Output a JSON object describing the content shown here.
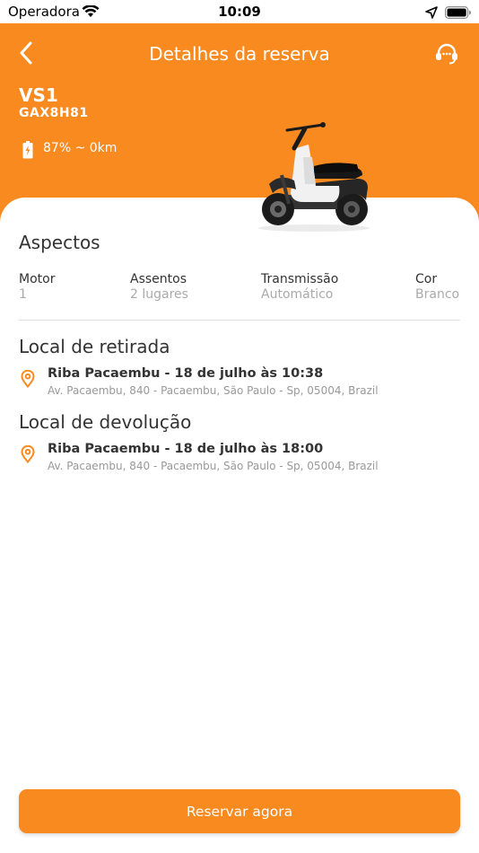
{
  "status_bar": {
    "carrier": "Operadora",
    "time": "10:09"
  },
  "header": {
    "title": "Detalhes da reserva",
    "back_icon": "chevron-left-icon",
    "support_icon": "headset-icon",
    "background_color": "#f98a1f"
  },
  "vehicle": {
    "model": "VS1",
    "plate": "GAX8H81",
    "battery_info": "87% ~ 0km",
    "image": "electric-scooter"
  },
  "aspects": {
    "title": "Aspectos",
    "specs": [
      {
        "label": "Motor",
        "value": "1"
      },
      {
        "label": "Assentos",
        "value": "2 lugares"
      },
      {
        "label": "Transmissão",
        "value": "Automático"
      },
      {
        "label": "Cor",
        "value": "Branco"
      }
    ]
  },
  "pickup": {
    "title": "Local de retirada",
    "main": "Riba Pacaembu - 18 de julho às 10:38",
    "address": "Av. Pacaembu, 840 - Pacaembu, São Paulo - Sp, 05004, Brazil"
  },
  "dropoff": {
    "title": "Local de devolução",
    "main": "Riba Pacaembu - 18 de julho às 18:00",
    "address": "Av. Pacaembu, 840 - Pacaembu, São Paulo - Sp, 05004, Brazil"
  },
  "cta": {
    "label": "Reservar agora"
  },
  "colors": {
    "accent": "#f98a1f",
    "text": "#333333",
    "muted": "#aaaaaa"
  }
}
